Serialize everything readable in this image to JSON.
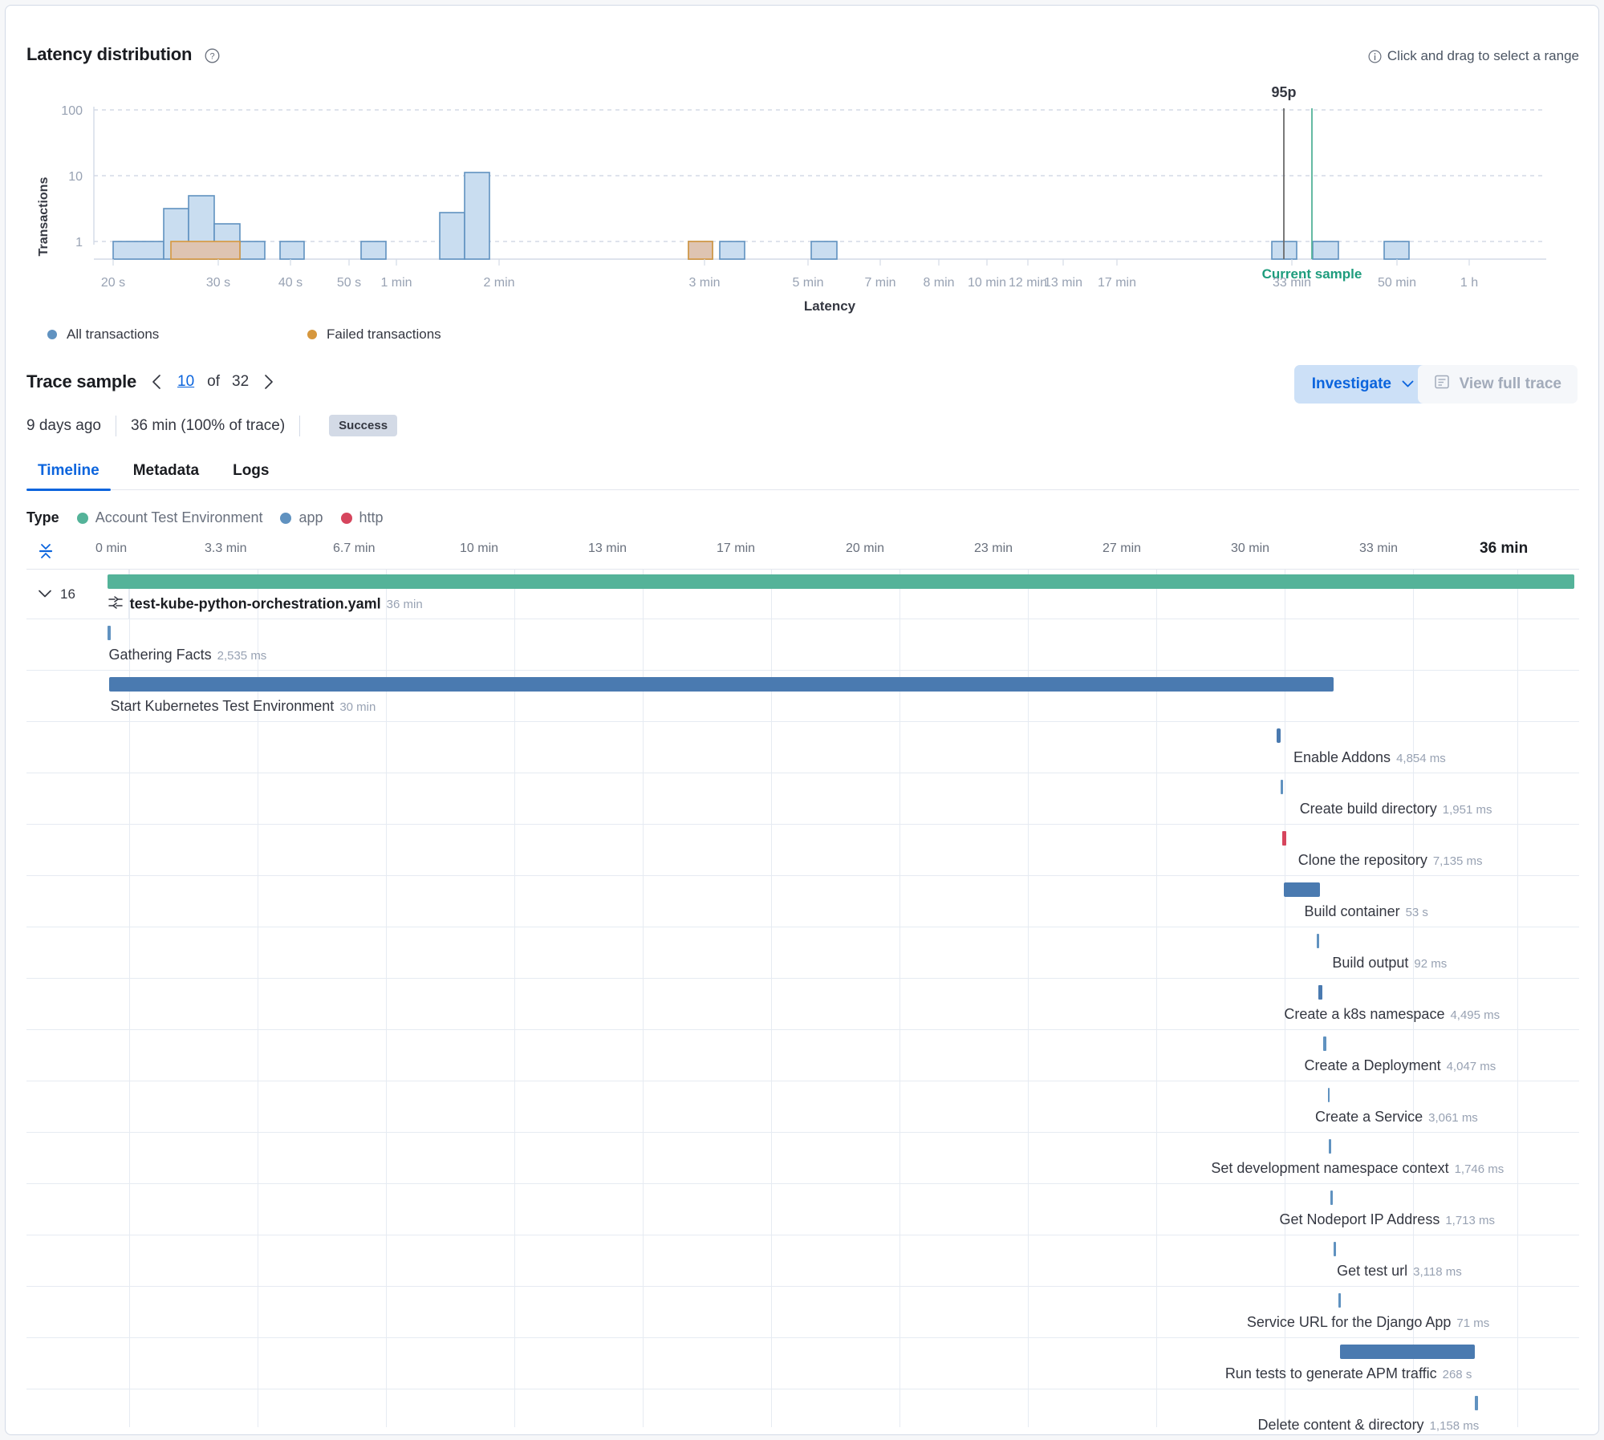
{
  "latency_panel": {
    "title": "Latency distribution",
    "help_icon": "help-circle-icon",
    "drag_hint": "Click and drag to select a range",
    "drag_hint_icon": "info-circle-icon"
  },
  "legend": [
    {
      "label": "All transactions",
      "color": "#6092c0"
    },
    {
      "label": "Failed transactions",
      "color": "#d6973d"
    }
  ],
  "chart_data": {
    "type": "bar",
    "title": "Latency distribution",
    "xlabel": "Latency",
    "ylabel": "Transactions",
    "yscale": "log",
    "ylim": [
      0,
      100
    ],
    "ytick_labels": [
      "1",
      "10",
      "100"
    ],
    "xtick_labels": [
      "20 s",
      "30 s",
      "40 s",
      "50 s",
      "1 min",
      "2 min",
      "3 min",
      "5 min",
      "7 min",
      "8 min",
      "10 min",
      "12 min",
      "13 min",
      "17 min",
      "33 min",
      "50 min",
      "1 h"
    ],
    "categories": [
      "20 s",
      "22 s",
      "25 s",
      "27 s",
      "29 s",
      "31 s",
      "33 s",
      "40 s",
      "50 s",
      "1.5 min",
      "1.7 min",
      "3 min",
      "3.2 min",
      "5 min",
      "32 min",
      "34 min",
      "50 min"
    ],
    "series": [
      {
        "name": "All transactions",
        "values": [
          1,
          1,
          3,
          4,
          2,
          1,
          1,
          1,
          1,
          2,
          7,
          1,
          1,
          1,
          1,
          1,
          1
        ]
      },
      {
        "name": "Failed transactions",
        "values": [
          0,
          0,
          0,
          1,
          1,
          0,
          0,
          0,
          0,
          0,
          0,
          1,
          0,
          0,
          0,
          0,
          0
        ]
      }
    ],
    "annotations": [
      {
        "label": "95p",
        "color": "#6b6b6b"
      },
      {
        "label": "Current sample",
        "color": "#2aab8f"
      }
    ],
    "grid": true,
    "legend_position": "bottom-left"
  },
  "trace_sample": {
    "title": "Trace sample",
    "prev_icon": "chevron-left-icon",
    "next_icon": "chevron-right-icon",
    "current_index": "10",
    "of_label": "of",
    "total": "32",
    "age": "9 days ago",
    "duration": "36 min (100% of trace)",
    "status_badge": "Success",
    "investigate_label": "Investigate",
    "investigate_icon": "chevron-down-icon",
    "view_full_trace_label": "View full trace",
    "view_full_trace_icon": "document-icon"
  },
  "tabs": [
    {
      "label": "Timeline",
      "active": true
    },
    {
      "label": "Metadata",
      "active": false
    },
    {
      "label": "Logs",
      "active": false
    }
  ],
  "type_legend": {
    "label": "Type",
    "items": [
      {
        "label": "Account Test Environment",
        "color": "#54b399"
      },
      {
        "label": "app",
        "color": "#6092c0"
      },
      {
        "label": "http",
        "color": "#d6455d"
      }
    ]
  },
  "timeline": {
    "collapse_icon": "collapse-rows-icon",
    "ticks": [
      "0 min",
      "3.3 min",
      "6.7 min",
      "10 min",
      "13 min",
      "17 min",
      "20 min",
      "23 min",
      "27 min",
      "30 min",
      "33 min",
      "36 min"
    ],
    "accordion_count": "16",
    "accordion_icon": "chevron-down-icon",
    "rows": [
      {
        "name": "test-kube-python-orchestration.yaml",
        "duration": "36 min",
        "color": "#54b399",
        "left_pct": 5.2,
        "width_pct": 94.5,
        "label_left_pct": 5.2,
        "root": true,
        "icon": "transaction-icon"
      },
      {
        "name": "Gathering Facts",
        "duration": "2,535 ms",
        "color": "#6092c0",
        "left_pct": 5.2,
        "width_pct": 0.25,
        "label_left_pct": 5.3
      },
      {
        "name": "Start Kubernetes Test Environment",
        "duration": "30 min",
        "color": "#4a7ab0",
        "left_pct": 5.3,
        "width_pct": 78.9,
        "label_left_pct": 5.4
      },
      {
        "name": "Enable Addons",
        "duration": "4,854 ms",
        "color": "#4a7ab0",
        "left_pct": 80.5,
        "width_pct": 0.3,
        "label_left_pct": 81.6
      },
      {
        "name": "Create build directory",
        "duration": "1,951 ms",
        "color": "#6092c0",
        "left_pct": 80.8,
        "width_pct": 0.14,
        "label_left_pct": 82.0
      },
      {
        "name": "Clone the repository",
        "duration": "7,135 ms",
        "color": "#d6455d",
        "left_pct": 80.9,
        "width_pct": 0.25,
        "label_left_pct": 81.9
      },
      {
        "name": "Build container",
        "duration": "53 s",
        "color": "#4a7ab0",
        "left_pct": 81.0,
        "width_pct": 2.3,
        "label_left_pct": 82.3
      },
      {
        "name": "Build output",
        "duration": "92 ms",
        "color": "#6092c0",
        "left_pct": 83.1,
        "width_pct": 0.14,
        "label_left_pct": 84.1
      },
      {
        "name": "Create a k8s namespace",
        "duration": "4,495 ms",
        "color": "#4a7ab0",
        "left_pct": 83.2,
        "width_pct": 0.25,
        "label_left_pct": 81.0
      },
      {
        "name": "Create a Deployment",
        "duration": "4,047 ms",
        "color": "#6092c0",
        "left_pct": 83.5,
        "width_pct": 0.2,
        "label_left_pct": 82.3
      },
      {
        "name": "Create a Service",
        "duration": "3,061 ms",
        "color": "#6092c0",
        "left_pct": 83.8,
        "width_pct": 0.14,
        "label_left_pct": 83.0
      },
      {
        "name": "Set development namespace context",
        "duration": "1,746 ms",
        "color": "#6092c0",
        "left_pct": 83.9,
        "width_pct": 0.14,
        "label_left_pct": 76.3
      },
      {
        "name": "Get Nodeport IP Address",
        "duration": "1,713 ms",
        "color": "#6092c0",
        "left_pct": 84.0,
        "width_pct": 0.14,
        "label_left_pct": 80.7
      },
      {
        "name": "Get test url",
        "duration": "3,118 ms",
        "color": "#6092c0",
        "left_pct": 84.2,
        "width_pct": 0.14,
        "label_left_pct": 84.4
      },
      {
        "name": "Service URL for the Django App",
        "duration": "71 ms",
        "color": "#6092c0",
        "left_pct": 84.5,
        "width_pct": 0.14,
        "label_left_pct": 78.6
      },
      {
        "name": "Run tests to generate APM traffic",
        "duration": "268 s",
        "color": "#4a7ab0",
        "left_pct": 84.6,
        "width_pct": 8.7,
        "label_left_pct": 77.2
      },
      {
        "name": "Delete content & directory",
        "duration": "1,158 ms",
        "color": "#6092c0",
        "left_pct": 93.3,
        "width_pct": 0.2,
        "label_left_pct": 79.3
      }
    ]
  }
}
